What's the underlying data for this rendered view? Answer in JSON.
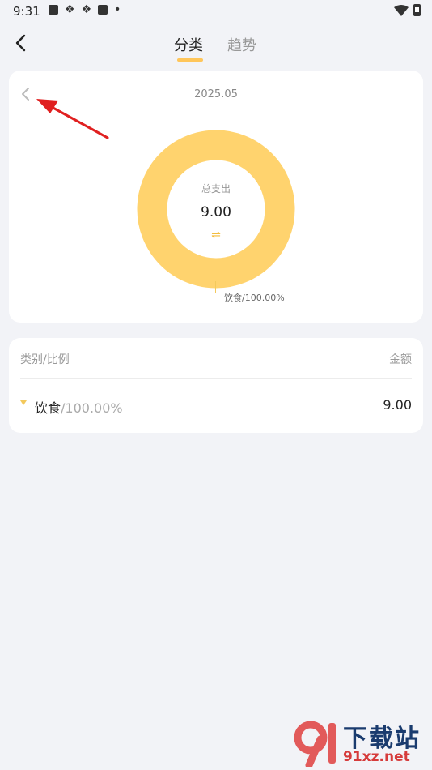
{
  "status_bar": {
    "time": "9:31"
  },
  "tabs": [
    {
      "label": "分类",
      "active": true
    },
    {
      "label": "趋势",
      "active": false
    }
  ],
  "summary": {
    "month": "2025.05",
    "total_label": "总支出",
    "total_value": "9.00",
    "swap_icon": "⇌"
  },
  "chart_data": {
    "type": "pie",
    "style": "donut",
    "slices": [
      {
        "label": "饮食/100.00%",
        "category": "饮食",
        "value": 9.0,
        "percent": 100.0,
        "color": "#ffd36e"
      }
    ]
  },
  "list": {
    "header_left": "类别/比例",
    "header_right": "金额",
    "rows": [
      {
        "name": "饮食",
        "percent": "/100.00%",
        "amount": "9.00"
      }
    ]
  },
  "watermark": {
    "top": "下载站",
    "bottom": "91xz.net",
    "logo": "91"
  },
  "colors": {
    "accent": "#ffc65a",
    "donut": "#ffd36e",
    "annotation_arrow": "#e02020"
  }
}
